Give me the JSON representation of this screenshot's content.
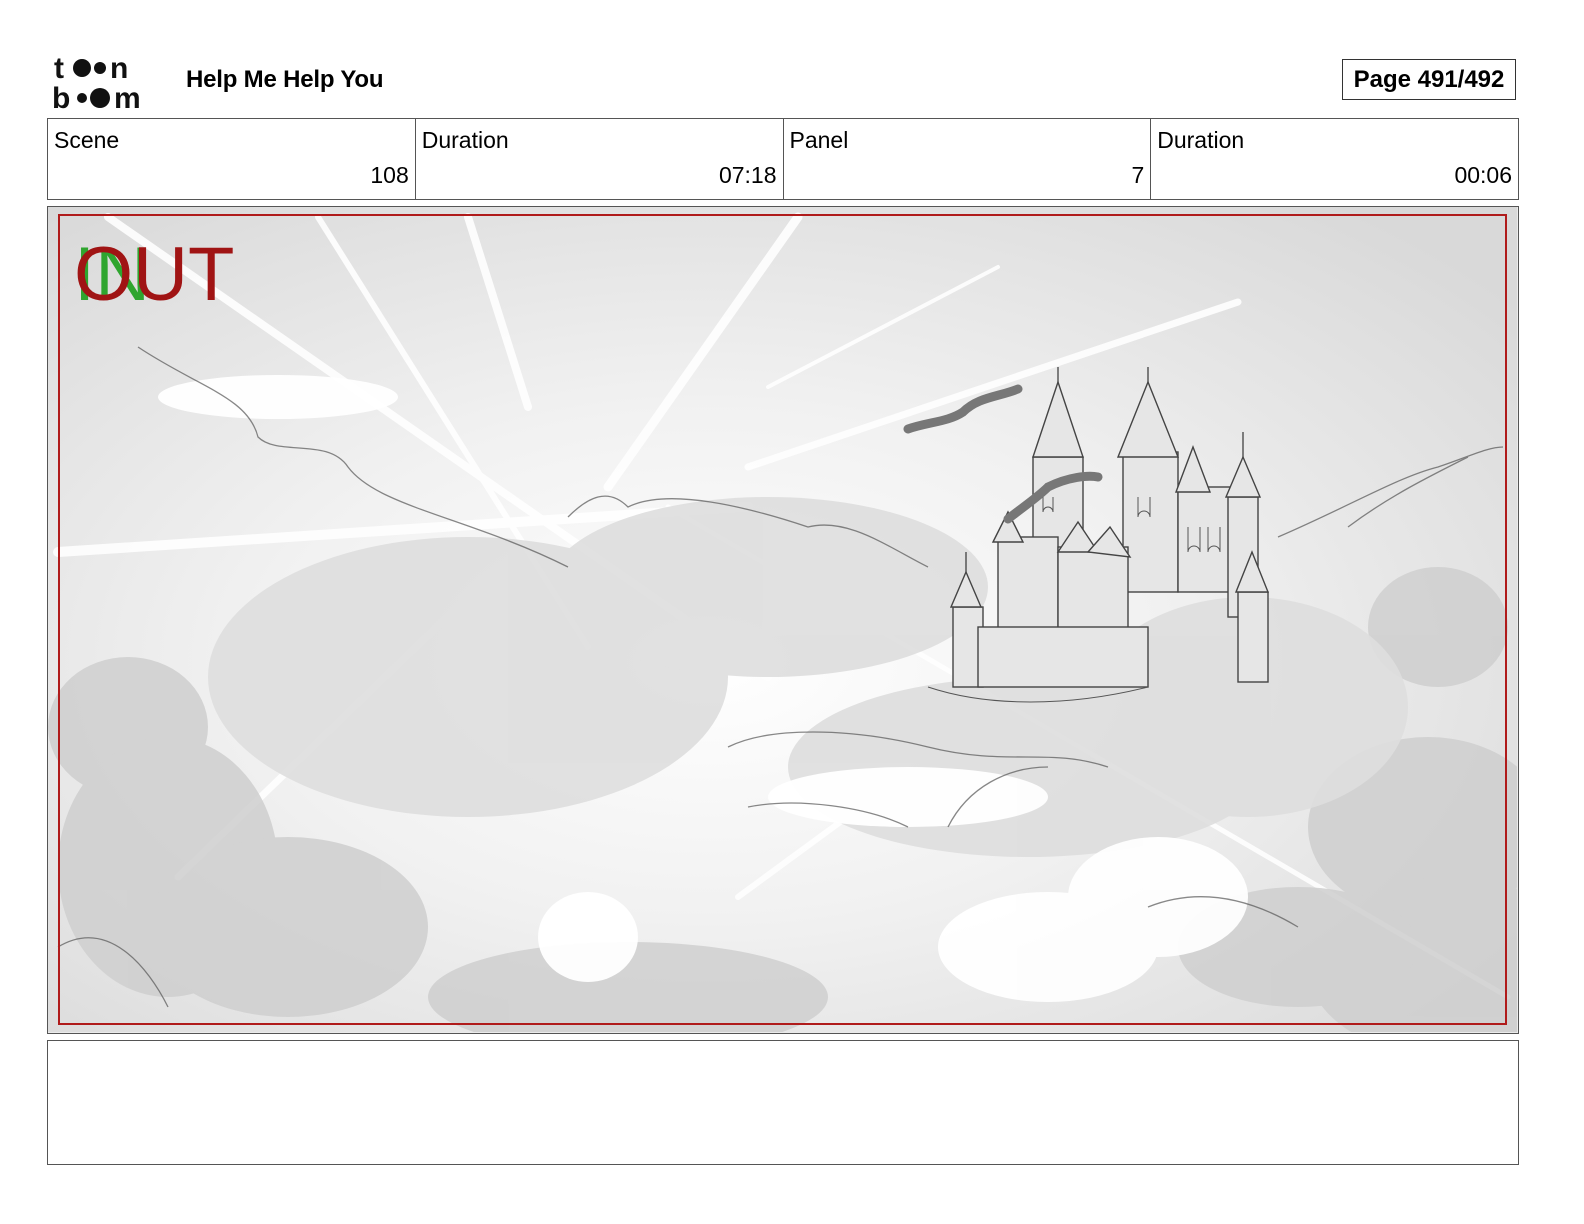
{
  "header": {
    "logo_text": "toon boom",
    "project_title": "Help Me Help You",
    "page_label": "Page 491/492"
  },
  "info": {
    "scene_label": "Scene",
    "scene_value": "108",
    "scene_duration_label": "Duration",
    "scene_duration_value": "07:18",
    "panel_label": "Panel",
    "panel_value": "7",
    "panel_duration_label": "Duration",
    "panel_duration_value": "00:06"
  },
  "panel": {
    "in_marker": "IN",
    "out_marker": "OUT",
    "in_color": "#2fa52f",
    "out_color": "#a01414",
    "frame_color": "#b01b1b",
    "image_subject": "castle-in-clouds-sketch"
  },
  "notes": {
    "text": ""
  }
}
